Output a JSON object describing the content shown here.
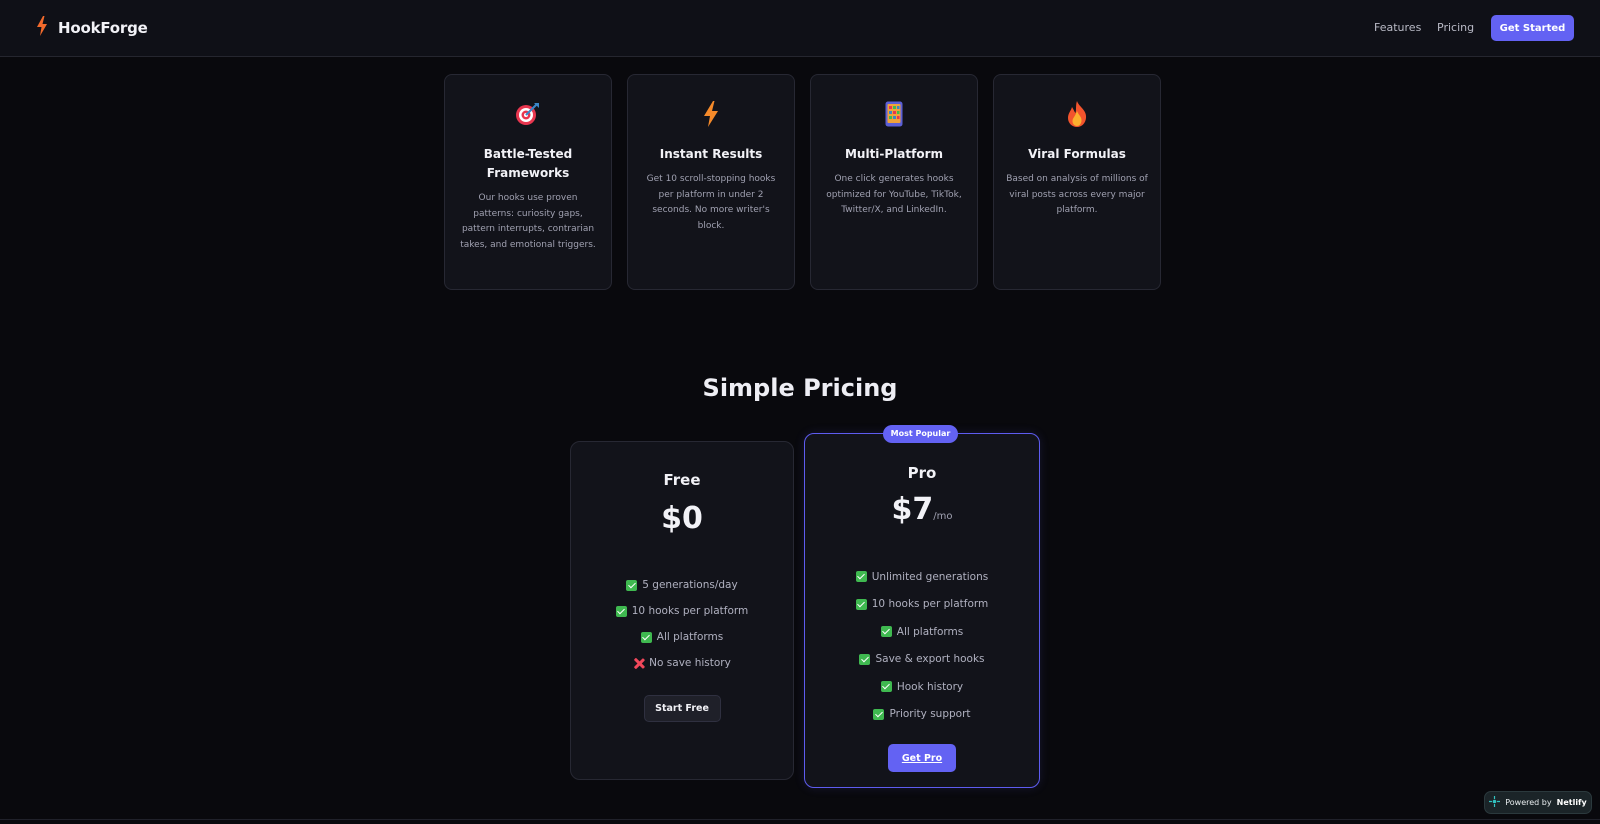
{
  "header": {
    "brand_name": "HookForge",
    "brand_icon": "lightning-bolt-icon",
    "nav_links": [
      "Features",
      "Pricing"
    ],
    "cta_label": "Get Started"
  },
  "features": [
    {
      "icon": "direct-hit-target-icon",
      "title": "Battle-Tested Frameworks",
      "description": "Our hooks use proven patterns: curiosity gaps, pattern interrupts, contrarian takes, and emotional triggers."
    },
    {
      "icon": "lightning-bolt-icon",
      "title": "Instant Results",
      "description": "Get 10 scroll-stopping hooks per platform in under 2 seconds. No more writer's block."
    },
    {
      "icon": "mobile-phone-icon",
      "title": "Multi-Platform",
      "description": "One click generates hooks optimized for YouTube, TikTok, Twitter/X, and LinkedIn."
    },
    {
      "icon": "fire-icon",
      "title": "Viral Formulas",
      "description": "Based on analysis of millions of viral posts across every major platform."
    }
  ],
  "pricing": {
    "title": "Simple Pricing",
    "free": {
      "name": "Free",
      "price": "$0",
      "features": [
        {
          "text": "5 generations/day",
          "included": true
        },
        {
          "text": "10 hooks per platform",
          "included": true
        },
        {
          "text": "All platforms",
          "included": true
        },
        {
          "text": "No save history",
          "included": false
        }
      ],
      "button": "Start Free"
    },
    "pro": {
      "badge": "Most Popular",
      "name": "Pro",
      "price": "$7",
      "price_suffix": "/mo",
      "features": [
        {
          "text": "Unlimited generations",
          "included": true
        },
        {
          "text": "10 hooks per platform",
          "included": true
        },
        {
          "text": "All platforms",
          "included": true
        },
        {
          "text": "Save & export hooks",
          "included": true
        },
        {
          "text": "Hook history",
          "included": true
        },
        {
          "text": "Priority support",
          "included": true
        }
      ],
      "button": "Get Pro"
    }
  },
  "netlify_badge": {
    "prefix": "Powered by",
    "name": "Netlify"
  },
  "colors": {
    "accent": "#6362f3",
    "check": "#3fb950",
    "cross": "#f0485b",
    "background": "#09090d"
  }
}
